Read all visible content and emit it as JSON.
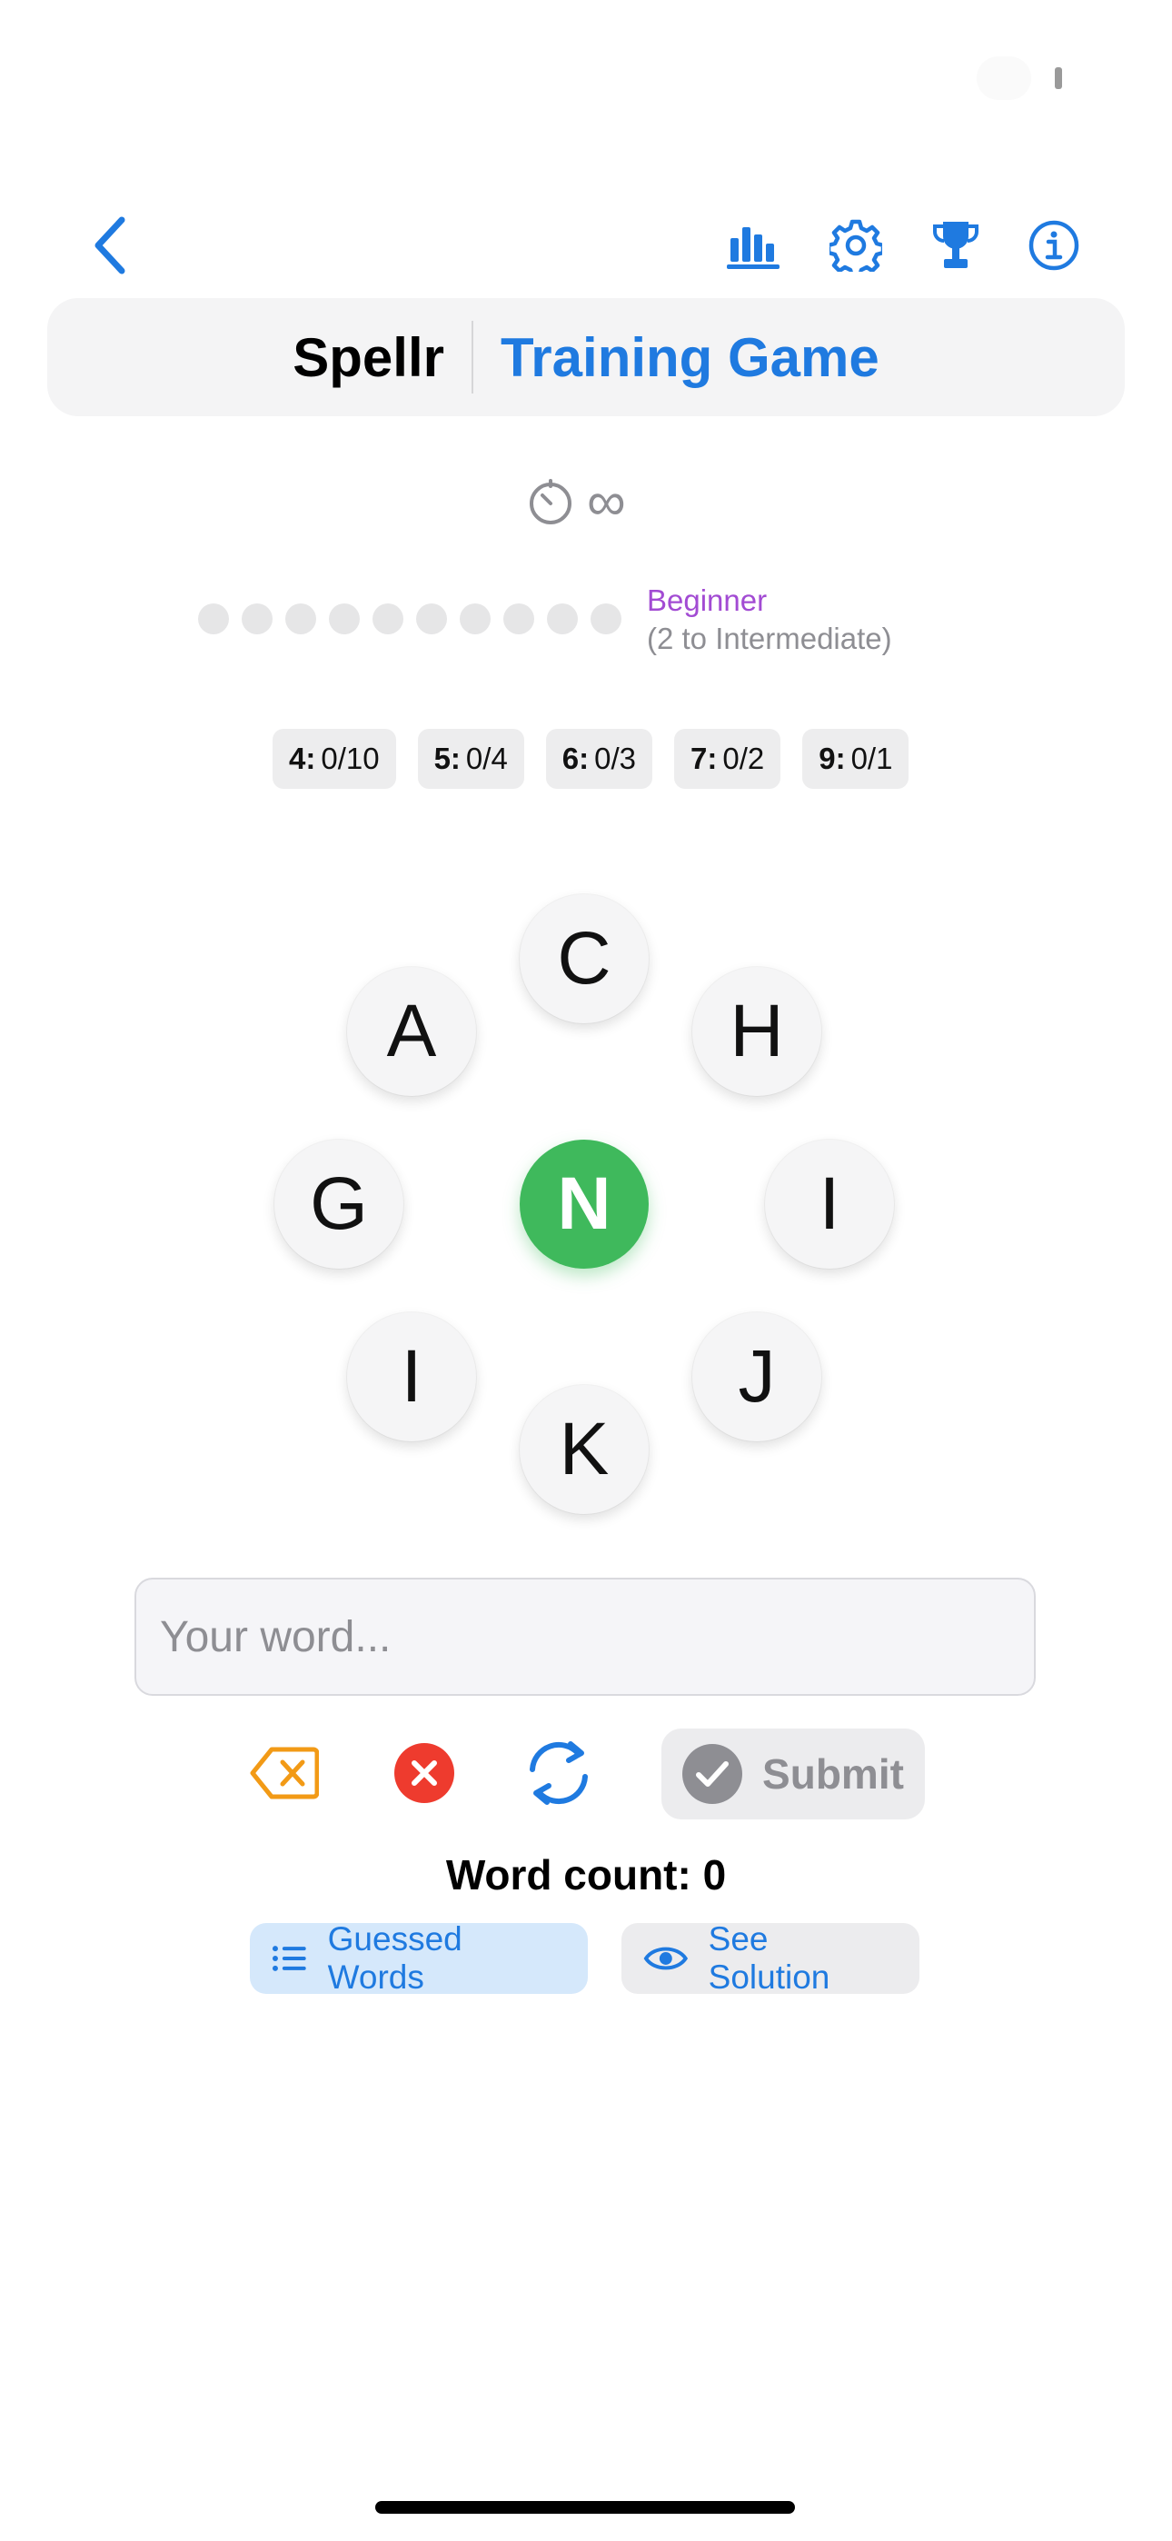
{
  "header": {
    "app_name": "Spellr",
    "mode": "Training Game",
    "accent": "#1f7ae0"
  },
  "nav": {
    "back_icon": "chevron-left-icon",
    "icons": [
      "bar-chart-icon",
      "gear-icon",
      "trophy-icon",
      "info-icon"
    ]
  },
  "timer": {
    "icon": "stopwatch-icon",
    "value": "∞"
  },
  "progress": {
    "dots_total": 10,
    "dots_filled": 0,
    "level": "Beginner",
    "next_level": "(2 to Intermediate)",
    "level_color": "#a24bd3"
  },
  "counters": [
    {
      "length": "4:",
      "value": "0/10"
    },
    {
      "length": "5:",
      "value": "0/4"
    },
    {
      "length": "6:",
      "value": "0/3"
    },
    {
      "length": "7:",
      "value": "0/2"
    },
    {
      "length": "9:",
      "value": "0/1"
    }
  ],
  "letters": {
    "center": "N",
    "outer": [
      "C",
      "A",
      "H",
      "G",
      "I",
      "I",
      "J",
      "K"
    ],
    "center_color": "#3fb95c"
  },
  "input": {
    "placeholder": "Your word...",
    "value": ""
  },
  "controls": {
    "backspace_icon": "backspace-icon",
    "clear_icon": "clear-x-icon",
    "shuffle_icon": "shuffle-icon",
    "submit_label": "Submit"
  },
  "word_count_label": "Word count: 0",
  "buttons": {
    "guessed_words": "Guessed Words",
    "see_solution": "See Solution"
  }
}
